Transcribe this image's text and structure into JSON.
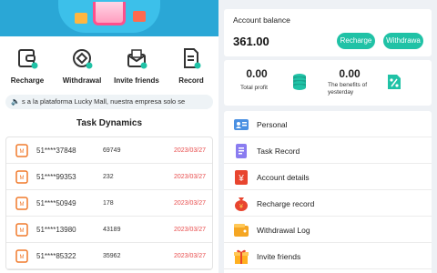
{
  "menu": {
    "items": [
      {
        "label": "Recharge",
        "icon": "wallet-icon"
      },
      {
        "label": "Withdrawal",
        "icon": "withdraw-icon"
      },
      {
        "label": "Invite friends",
        "icon": "envelope-icon"
      },
      {
        "label": "Record",
        "icon": "record-icon"
      }
    ]
  },
  "notice": {
    "text": "s a la plataforma Lucky Mall, nuestra empresa solo se",
    "icon": "speaker-icon"
  },
  "task_dynamics": {
    "title": "Task Dynamics",
    "rows": [
      {
        "user": "51****37848",
        "amount": "69749",
        "date": "2023/03/27"
      },
      {
        "user": "51****99353",
        "amount": "232",
        "date": "2023/03/27"
      },
      {
        "user": "51****50949",
        "amount": "178",
        "date": "2023/03/27"
      },
      {
        "user": "51****13980",
        "amount": "43189",
        "date": "2023/03/27"
      },
      {
        "user": "51****85322",
        "amount": "35962",
        "date": "2023/03/27"
      }
    ]
  },
  "account": {
    "balance_label": "Account balance",
    "balance_value": "361.00",
    "recharge_label": "Recharge",
    "withdraw_label": "Withdrawa"
  },
  "stats": {
    "total_profit_value": "0.00",
    "total_profit_label": "Total profit",
    "yesterday_value": "0.00",
    "yesterday_label_1": "The benefits of",
    "yesterday_label_2": "yesterday"
  },
  "nav": {
    "items": [
      {
        "label": "Personal",
        "icon": "user-card-icon"
      },
      {
        "label": "Task Record",
        "icon": "task-record-icon"
      },
      {
        "label": "Account details",
        "icon": "yen-icon"
      },
      {
        "label": "Recharge record",
        "icon": "money-bag-icon"
      },
      {
        "label": "Withdrawal Log",
        "icon": "wallet-icon"
      },
      {
        "label": "Invite friends",
        "icon": "gift-icon"
      }
    ]
  },
  "colors": {
    "accent": "#20c2a6",
    "date_red": "#e84d4d",
    "banner_blue": "#2aa7d6",
    "avatar_orange": "#f07a2c"
  }
}
